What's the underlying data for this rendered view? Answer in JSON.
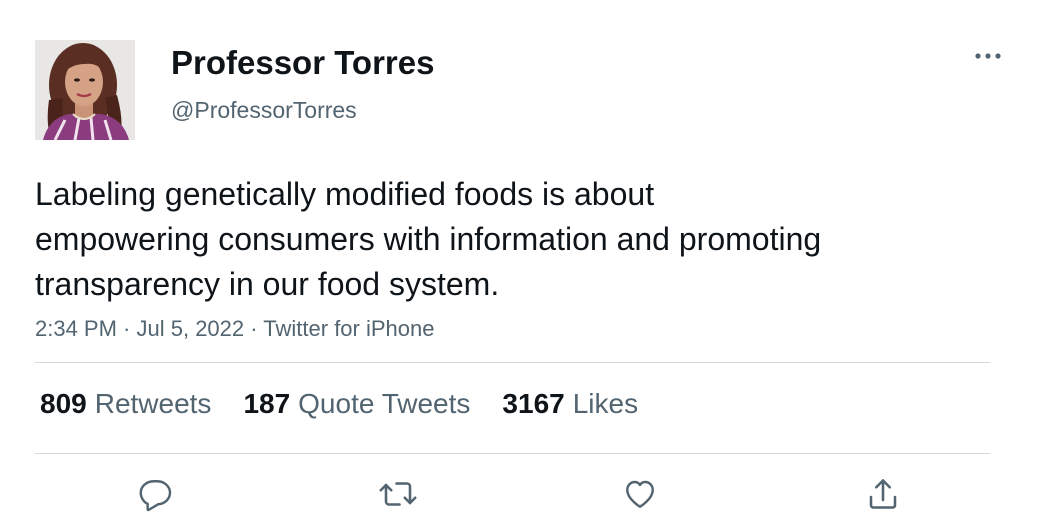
{
  "author": {
    "display_name": "Professor Torres",
    "handle": "@ProfessorTorres",
    "avatar_icon": "avatar-photo"
  },
  "more_icon": "more-horizontal-icon",
  "tweet": {
    "text_lines": [
      "Labeling genetically modified foods is about",
      "empowering consumers with information and promoting",
      "transparency in our food system."
    ]
  },
  "meta": {
    "time": "2:34 PM",
    "sep1": " · ",
    "date": "Jul 5, 2022",
    "sep2": " · ",
    "source": "Twitter for iPhone"
  },
  "stats": {
    "retweets": {
      "count": "809",
      "label": "Retweets"
    },
    "quote_tweets": {
      "count": "187",
      "label": "Quote Tweets"
    },
    "likes": {
      "count": "3167",
      "label": "Likes"
    }
  },
  "actions": {
    "reply_icon": "reply-icon",
    "retweet_icon": "retweet-icon",
    "like_icon": "like-icon",
    "share_icon": "share-icon"
  },
  "colors": {
    "primary_text": "#0f1419",
    "secondary_text": "#536471",
    "divider": "#cfd9de",
    "background": "#ffffff"
  }
}
